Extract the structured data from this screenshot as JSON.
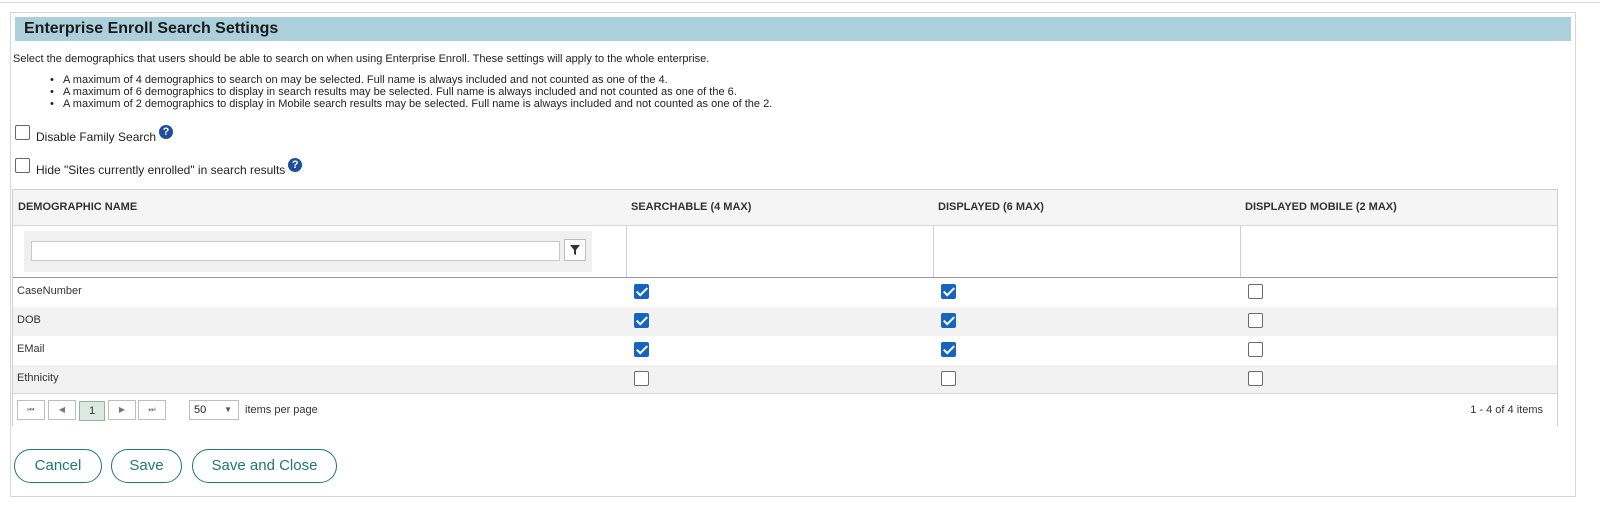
{
  "page": {
    "title": "Enterprise Enroll Search Settings",
    "intro": "Select the demographics that users should be able to search on when using Enterprise Enroll. These settings will apply to the whole enterprise.",
    "rules": [
      "A maximum of 4 demographics to search on may be selected. Full name is always included and not counted as one of the 4.",
      "A maximum of 6 demographics to display in search results may be selected. Full name is always included and not counted as one of the 6.",
      "A maximum of 2 demographics to display in Mobile search results may be selected. Full name is always included and not counted as one of the 2."
    ]
  },
  "options": {
    "disable_family": {
      "label": "Disable Family Search",
      "checked": false,
      "help_icon": "question-circle-icon"
    },
    "hide_sites": {
      "label": "Hide \"Sites currently enrolled\" in search results",
      "checked": false,
      "help_icon": "question-circle-icon"
    }
  },
  "grid": {
    "columns": [
      "DEMOGRAPHIC NAME",
      "SEARCHABLE (4 MAX)",
      "DISPLAYED (6 MAX)",
      "DISPLAYED MOBILE (2 MAX)"
    ],
    "filter": {
      "value": "",
      "icon": "filter-funnel-icon"
    },
    "rows": [
      {
        "name": "CaseNumber",
        "searchable": true,
        "displayed": true,
        "mobile": false
      },
      {
        "name": "DOB",
        "searchable": true,
        "displayed": true,
        "mobile": false
      },
      {
        "name": "EMail",
        "searchable": true,
        "displayed": true,
        "mobile": false
      },
      {
        "name": "Ethnicity",
        "searchable": false,
        "displayed": false,
        "mobile": false
      }
    ],
    "pager": {
      "first_icon": "first-page-icon",
      "prev_icon": "prev-page-icon",
      "current_page": "1",
      "next_icon": "next-page-icon",
      "last_icon": "last-page-icon",
      "page_size": "50",
      "page_size_label": "items per page",
      "info": "1 - 4 of 4 items"
    }
  },
  "actions": {
    "cancel": "Cancel",
    "save": "Save",
    "save_close": "Save and Close"
  },
  "colors": {
    "title_bar": "#abd0dc",
    "checkbox_checked": "#1565c0",
    "button_accent": "#1f7a6a",
    "help_icon": "#1e4f9c"
  }
}
